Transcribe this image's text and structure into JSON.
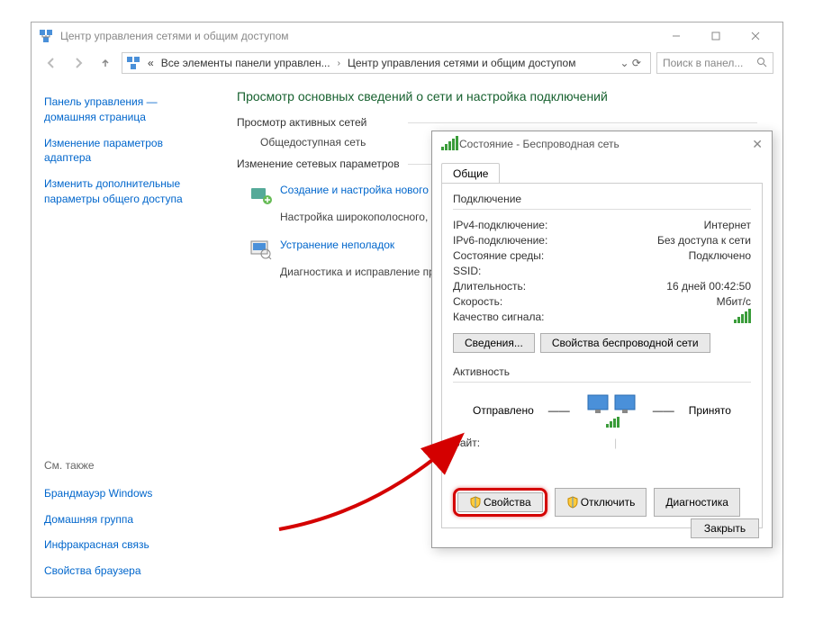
{
  "window": {
    "title": "Центр управления сетями и общим доступом"
  },
  "breadcrumb": {
    "pre": "«",
    "item1": "Все элементы панели управлен...",
    "item2": "Центр управления сетями и общим доступом"
  },
  "search": {
    "placeholder": "Поиск в панел..."
  },
  "sidebar": {
    "home": "Панель управления — домашняя страница",
    "link1": "Изменение параметров адаптера",
    "link2": "Изменить дополнительные параметры общего доступа",
    "seealso": "См. также",
    "l3": "Брандмауэр Windows",
    "l4": "Домашняя группа",
    "l5": "Инфракрасная связь",
    "l6": "Свойства браузера"
  },
  "content": {
    "heading": "Просмотр основных сведений о сети и настройка подключений",
    "sect1": "Просмотр активных сетей",
    "net1": "Общедоступная сеть",
    "sect2": "Изменение сетевых параметров",
    "it1_title": "Создание и настройка нового п",
    "it1_desc": "Настройка широкополосного, маршрутизатора или точки до",
    "it2_title": "Устранение неполадок",
    "it2_desc": "Диагностика и исправление пр неполадок."
  },
  "dialog": {
    "title": "Состояние - Беспроводная сеть",
    "tab": "Общие",
    "group1": "Подключение",
    "ipv4": {
      "k": "IPv4-подключение:",
      "v": "Интернет"
    },
    "ipv6": {
      "k": "IPv6-подключение:",
      "v": "Без доступа к сети"
    },
    "state": {
      "k": "Состояние среды:",
      "v": "Подключено"
    },
    "ssid": {
      "k": "SSID:",
      "v": ""
    },
    "duration": {
      "k": "Длительность:",
      "v": "16 дней 00:42:50"
    },
    "speed": {
      "k": "Скорость:",
      "v": "Мбит/с"
    },
    "quality": {
      "k": "Качество сигнала:",
      "v": ""
    },
    "btn_details": "Сведения...",
    "btn_wprops": "Свойства беспроводной сети",
    "group2": "Активность",
    "sent": "Отправлено",
    "received": "Принято",
    "bytes": {
      "k": "Байт:",
      "v1": "",
      "v2": ""
    },
    "btn_props": "Свойства",
    "btn_disable": "Отключить",
    "btn_diag": "Диагностика",
    "btn_close": "Закрыть"
  }
}
